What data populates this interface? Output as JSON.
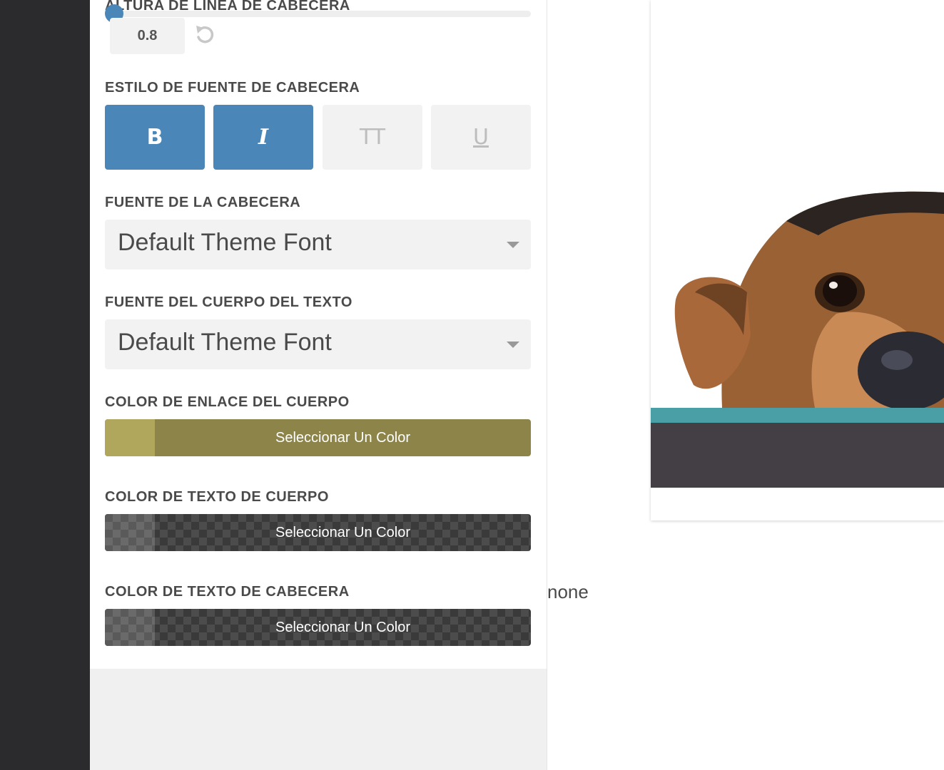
{
  "colors": {
    "accent": "#4a86b8",
    "link_color_main": "#8c8449",
    "link_color_swatch": "#b1a75c",
    "preview_teal": "#4a9ea6",
    "preview_dark": "#433f44",
    "left_rail": "#2b2a2c"
  },
  "line_height": {
    "label": "ALTURA DE LÍNEA DE CABECERA",
    "value": "0.8",
    "reset_icon": "undo-icon"
  },
  "header_font_style": {
    "label": "ESTILO DE FUENTE DE CABECERA",
    "buttons": [
      {
        "label": "B",
        "active": true
      },
      {
        "label": "I",
        "active": true
      },
      {
        "label": "TT",
        "active": false
      },
      {
        "label": "U",
        "active": false
      }
    ]
  },
  "header_font": {
    "label": "FUENTE DE LA CABECERA",
    "value": "Default Theme Font"
  },
  "body_font": {
    "label": "FUENTE DEL CUERPO DEL TEXTO",
    "value": "Default Theme Font"
  },
  "body_link_color": {
    "label": "COLOR DE ENLACE DEL CUERPO",
    "button_label": "Seleccionar Un Color"
  },
  "body_text_color": {
    "label": "COLOR DE TEXTO DE CUERPO",
    "button_label": "Seleccionar Un Color"
  },
  "header_text_color": {
    "label": "COLOR DE TEXTO DE CABECERA",
    "button_label": "Seleccionar Un Color"
  },
  "preview": {
    "none_text": "none",
    "image": "dog-photo"
  }
}
